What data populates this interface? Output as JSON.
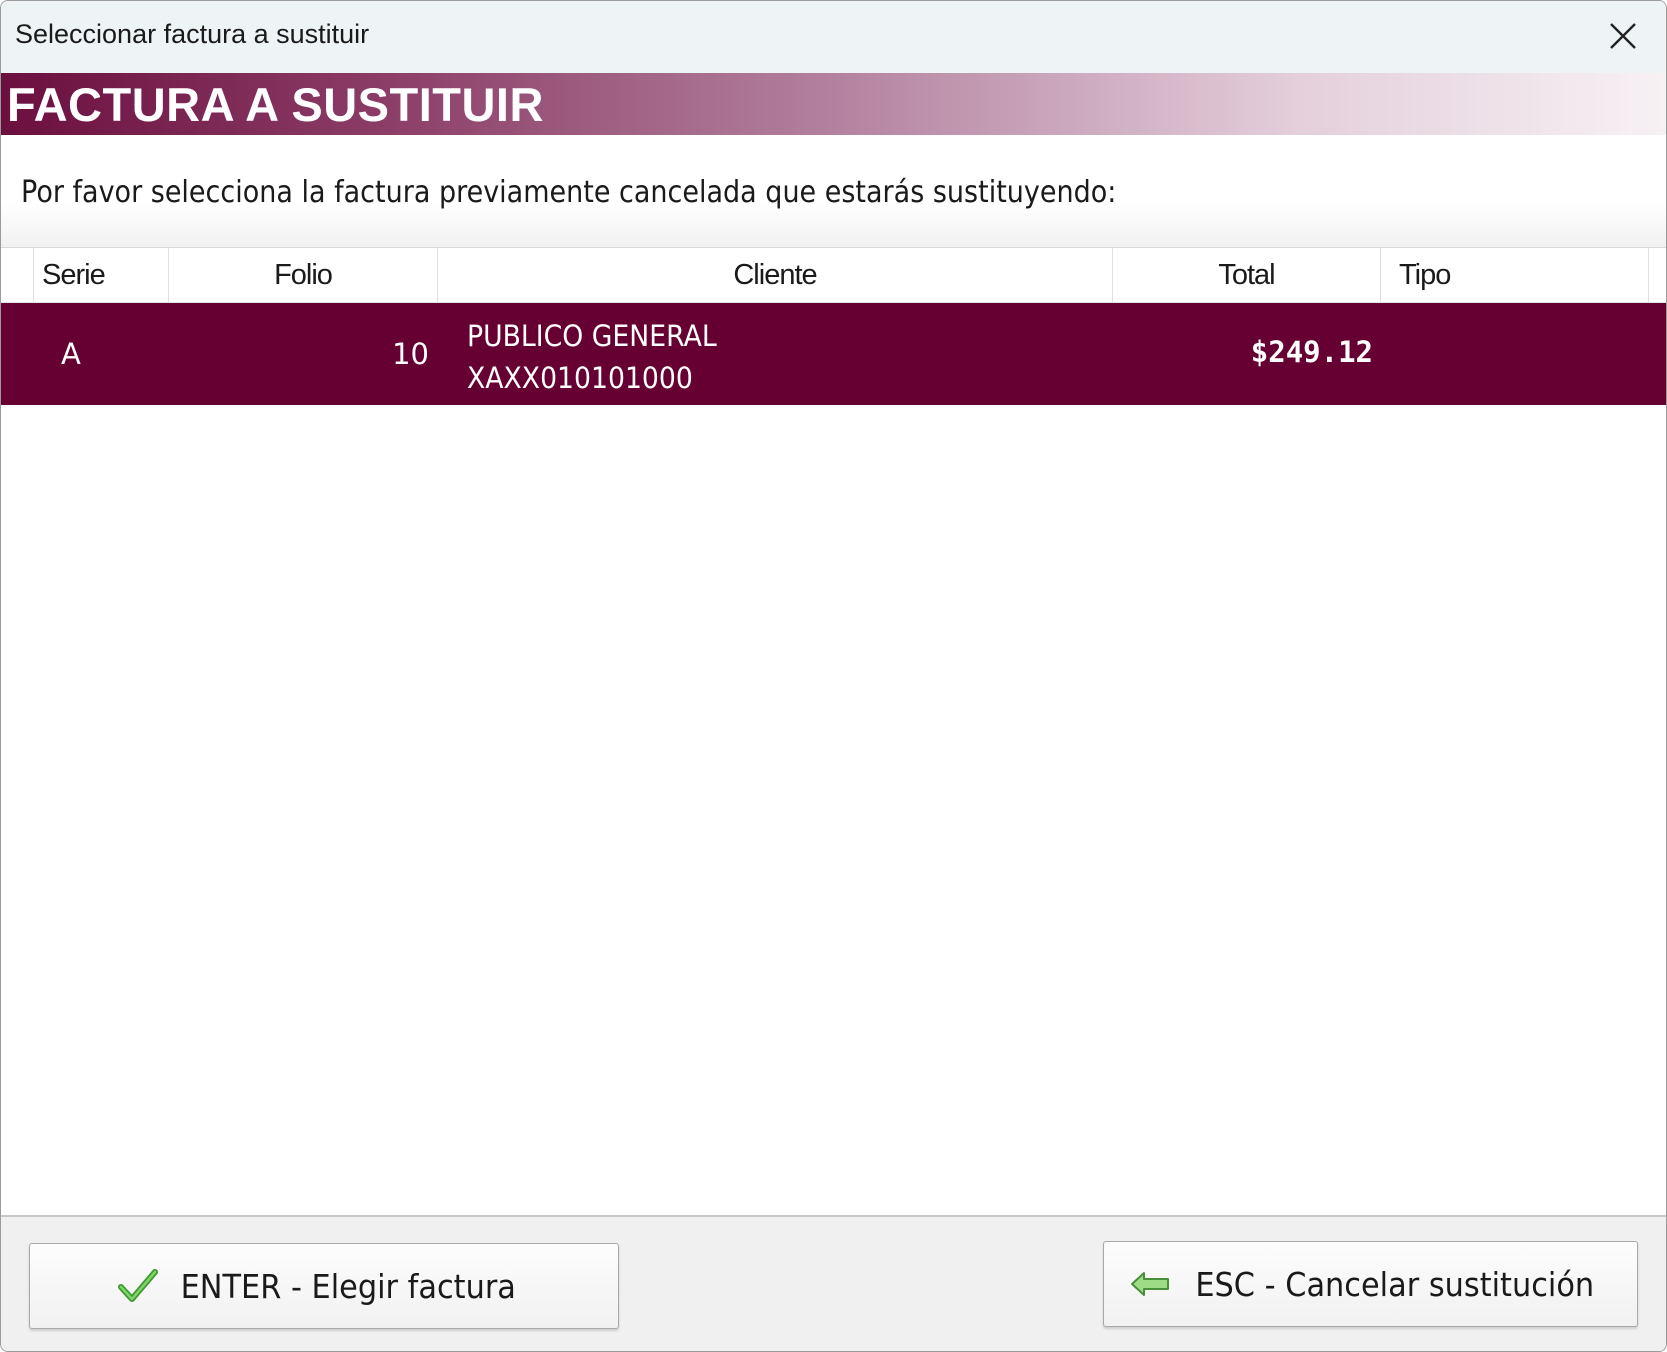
{
  "window": {
    "title": "Seleccionar factura a sustituir",
    "close_icon": "close-icon"
  },
  "banner": {
    "text": "FACTURA A SUSTITUIR",
    "gradient_start": "#6b0f3f",
    "gradient_end": "#f7f1f4"
  },
  "instruction": "Por favor selecciona la factura previamente cancelada que estarás sustituyendo:",
  "grid": {
    "columns": [
      "Serie",
      "Folio",
      "Cliente",
      "Total",
      "Tipo"
    ],
    "rows": [
      {
        "serie": "A",
        "folio": "10",
        "cliente_nombre": "PUBLICO GENERAL",
        "cliente_rfc": "XAXX010101000",
        "total": "$249.12",
        "tipo": "",
        "selected": true
      }
    ],
    "selected_row_color": "#660033"
  },
  "buttons": {
    "enter_label": "ENTER - Elegir factura",
    "enter_icon": "checkmark-icon",
    "esc_label": "ESC - Cancelar sustitución",
    "esc_icon": "arrow-left-icon"
  }
}
